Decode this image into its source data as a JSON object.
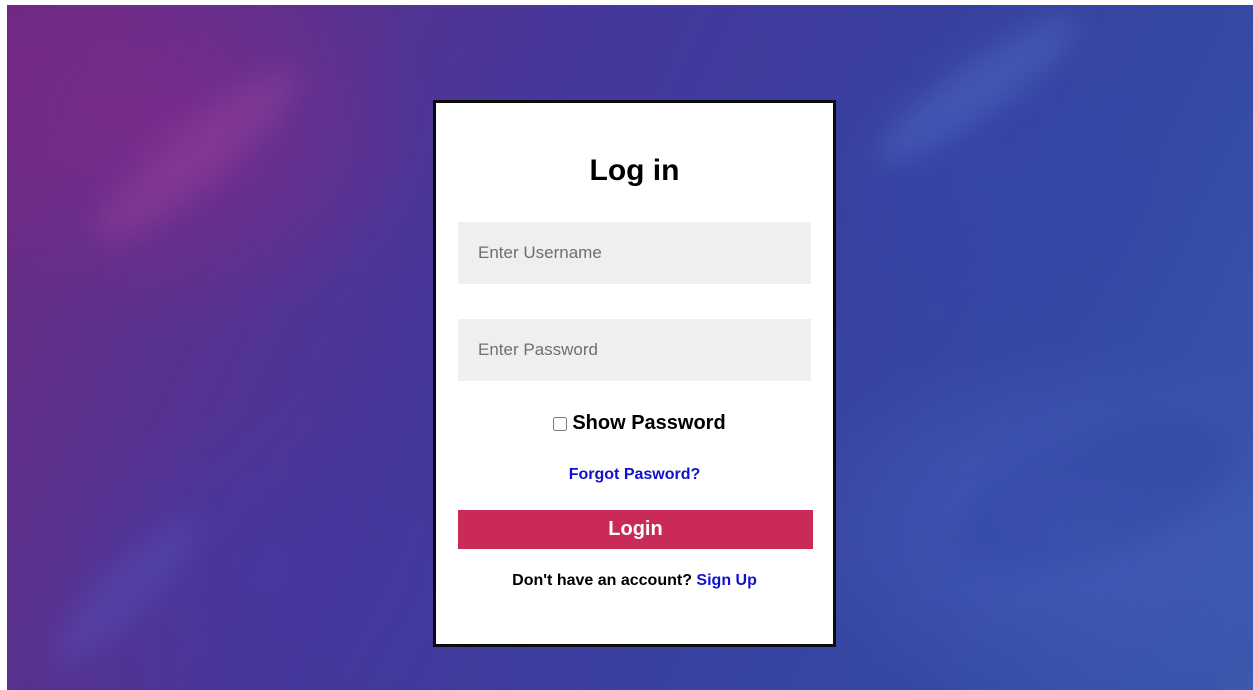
{
  "login_form": {
    "title": "Log in",
    "username_placeholder": "Enter Username",
    "password_placeholder": "Enter Password",
    "show_password_label": "Show Password",
    "show_password_checked": false,
    "forgot_password_label": "Forgot Pasword?",
    "login_button_label": "Login",
    "signup_prompt": "Don't have an account?",
    "signup_link_label": "Sign Up"
  },
  "colors": {
    "login_button": "#c92a57",
    "link": "#1111cc",
    "field_background": "#efefef",
    "card_border": "#0c0c0c"
  }
}
